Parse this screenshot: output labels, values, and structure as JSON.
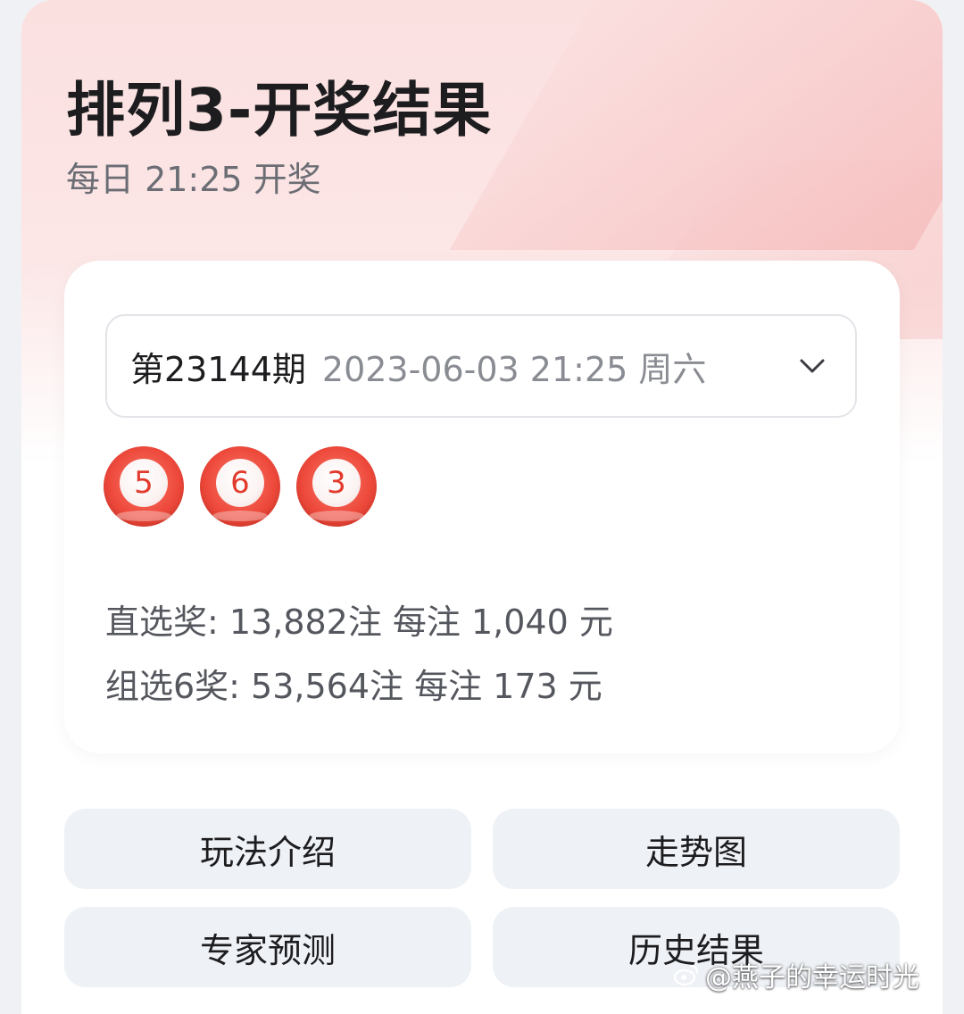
{
  "header": {
    "title": "排列3-开奖结果",
    "subtitle": "每日 21:25 开奖"
  },
  "draw": {
    "issue": "第23144期",
    "datetime": "2023-06-03 21:25 周六",
    "dropdown_icon": "chevron-down-icon",
    "numbers": [
      "5",
      "6",
      "3"
    ],
    "ball_color": "#ee4b3d"
  },
  "prizes": [
    {
      "text": "直选奖: 13,882注 每注 1,040 元"
    },
    {
      "text": "组选6奖: 53,564注 每注 173 元"
    }
  ],
  "actions": {
    "rules": "玩法介绍",
    "trend": "走势图",
    "expert": "专家预测",
    "history": "历史结果"
  },
  "watermark": {
    "text": "@燕子的幸运时光",
    "icon": "weibo-icon"
  },
  "colors": {
    "title": "#1d1d20",
    "subtle_text": "#6b6d74",
    "button_bg": "#eef1f5",
    "hero_tint": "#fbe0e0"
  }
}
